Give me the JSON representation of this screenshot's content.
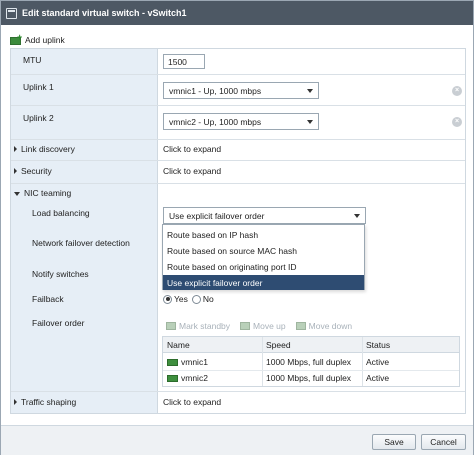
{
  "window": {
    "title": "Edit standard virtual switch - vSwitch1"
  },
  "toolbar": {
    "add_uplink_label": "Add uplink"
  },
  "mtu": {
    "label": "MTU",
    "value": "1500"
  },
  "uplink1": {
    "label": "Uplink 1",
    "value": "vmnic1 - Up, 1000 mbps"
  },
  "uplink2": {
    "label": "Uplink 2",
    "value": "vmnic2 - Up, 1000 mbps"
  },
  "link_discovery": {
    "label": "Link discovery",
    "value": "Click to expand"
  },
  "security": {
    "label": "Security",
    "value": "Click to expand"
  },
  "nic_teaming": {
    "label": "NIC teaming",
    "load_balancing": {
      "label": "Load balancing",
      "selected": "Use explicit failover order",
      "options": [
        "Route based on IP hash",
        "Route based on source MAC hash",
        "Route based on originating port ID",
        "Use explicit failover order"
      ]
    },
    "network_failover_detection": {
      "label": "Network failover detection"
    },
    "notify_switches": {
      "label": "Notify switches"
    },
    "failback": {
      "label": "Failback",
      "yes": "Yes",
      "no": "No",
      "selected": "Yes"
    },
    "failover_order": {
      "label": "Failover order",
      "tools": {
        "mark_standby": "Mark standby",
        "move_up": "Move up",
        "move_down": "Move down"
      },
      "columns": [
        "Name",
        "Speed",
        "Status"
      ],
      "rows": [
        {
          "name": "vmnic1",
          "speed": "1000 Mbps, full duplex",
          "status": "Active"
        },
        {
          "name": "vmnic2",
          "speed": "1000 Mbps, full duplex",
          "status": "Active"
        }
      ]
    }
  },
  "traffic_shaping": {
    "label": "Traffic shaping",
    "value": "Click to expand"
  },
  "footer": {
    "save_label": "Save",
    "cancel_label": "Cancel"
  },
  "colors": {
    "title_bar": "#4d5864",
    "label_column": "#e6eef6",
    "selected_option": "#2e4c72",
    "nic_icon": "#3e8f3e"
  },
  "icons": [
    "switch-icon",
    "add-uplink-icon",
    "clear-icon",
    "nic-icon",
    "mark-standby-icon",
    "move-up-icon",
    "move-down-icon"
  ]
}
